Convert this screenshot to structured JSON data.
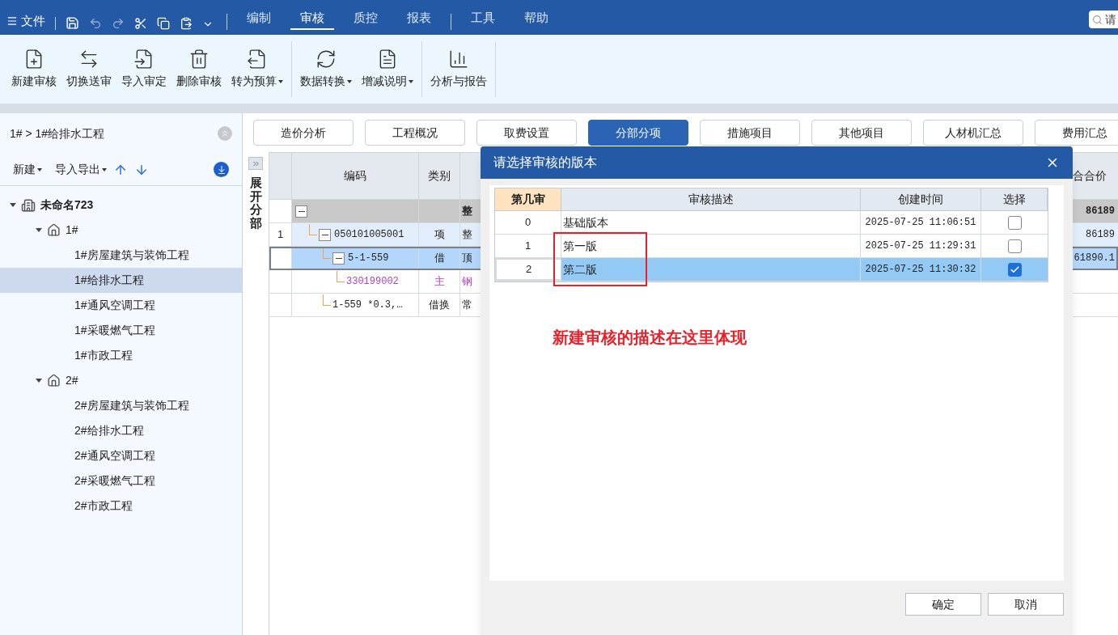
{
  "menu": {
    "file": "文件",
    "tabs": [
      {
        "label": "编制",
        "selected": false,
        "divider_before": false
      },
      {
        "label": "审核",
        "selected": true,
        "divider_before": false
      },
      {
        "label": "质控",
        "selected": false,
        "divider_before": false
      },
      {
        "label": "报表",
        "selected": false,
        "divider_before": false
      },
      {
        "label": "工具",
        "selected": false,
        "divider_before": true
      },
      {
        "label": "帮助",
        "selected": false,
        "divider_before": false
      }
    ],
    "search": {
      "placeholder": "请"
    }
  },
  "ribbon": [
    [
      {
        "label": "新建审核",
        "dropdown": false
      },
      {
        "label": "切换送审",
        "dropdown": false
      },
      {
        "label": "导入审定",
        "dropdown": false
      },
      {
        "label": "删除审核",
        "dropdown": false
      },
      {
        "label": "转为预算",
        "dropdown": true
      }
    ],
    [
      {
        "label": "数据转换",
        "dropdown": true
      },
      {
        "label": "增减说明",
        "dropdown": true
      }
    ],
    [
      {
        "label": "分析与报告",
        "dropdown": false
      }
    ]
  ],
  "sidebar": {
    "breadcrumb": "1# > 1#给排水工程",
    "toolbar": [
      {
        "label": "新建",
        "dropdown": true
      },
      {
        "label": "导入导出",
        "dropdown": true
      }
    ],
    "tree": [
      {
        "label": "未命名723",
        "kind": "project",
        "expanded": true,
        "selected": false,
        "children": [
          {
            "label": "1#",
            "kind": "building",
            "expanded": true,
            "selected": false,
            "children": [
              {
                "label": "1#房屋建筑与装饰工程",
                "selected": false
              },
              {
                "label": "1#给排水工程",
                "selected": true
              },
              {
                "label": "1#通风空调工程",
                "selected": false
              },
              {
                "label": "1#采暖燃气工程",
                "selected": false
              },
              {
                "label": "1#市政工程",
                "selected": false
              }
            ]
          },
          {
            "label": "2#",
            "kind": "building",
            "expanded": true,
            "selected": false,
            "children": [
              {
                "label": "2#房屋建筑与装饰工程",
                "selected": false
              },
              {
                "label": "2#给排水工程",
                "selected": false
              },
              {
                "label": "2#通风空调工程",
                "selected": false
              },
              {
                "label": "2#采暖燃气工程",
                "selected": false
              },
              {
                "label": "2#市政工程",
                "selected": false
              }
            ]
          }
        ]
      }
    ]
  },
  "tabs": [
    {
      "label": "造价分析",
      "selected": false
    },
    {
      "label": "工程概况",
      "selected": false
    },
    {
      "label": "取费设置",
      "selected": false
    },
    {
      "label": "分部分项",
      "selected": true
    },
    {
      "label": "措施项目",
      "selected": false
    },
    {
      "label": "其他项目",
      "selected": false
    },
    {
      "label": "人材机汇总",
      "selected": false
    },
    {
      "label": "费用汇总",
      "selected": false
    }
  ],
  "side_strip": "展开分部",
  "table": {
    "columns": [
      "编码",
      "类别",
      "合合价"
    ],
    "rows": [
      {
        "kind": "group",
        "name": "整",
        "price": "86189",
        "selected": false,
        "children": [
          {
            "kind": "item",
            "num": "1",
            "code": "050101005001",
            "type": "项",
            "name": "整",
            "price": "86189",
            "selected": false,
            "children": [
              {
                "kind": "item",
                "code": "5-1-559",
                "type": "借",
                "name": "顶",
                "price": "61890.1",
                "selected": true,
                "children": [
                  {
                    "kind": "material",
                    "code": "330199002",
                    "type": "主",
                    "name": "钢",
                    "selected": false
                  }
                ]
              },
              {
                "kind": "item",
                "code": "1-559 *0.3,…",
                "type": "借换",
                "name": "常",
                "selected": false
              }
            ]
          }
        ]
      }
    ]
  },
  "dialog": {
    "title": "请选择审核的版本",
    "columns": [
      "第几审",
      "审核描述",
      "创建时间",
      "选择"
    ],
    "rows": [
      {
        "index": "0",
        "description": "基础版本",
        "time": "2025-07-25 11:06:51",
        "checked": false,
        "selected": false
      },
      {
        "index": "1",
        "description": "第一版",
        "time": "2025-07-25 11:29:31",
        "checked": false,
        "selected": false
      },
      {
        "index": "2",
        "description": "第二版",
        "time": "2025-07-25 11:30:32",
        "checked": true,
        "selected": true
      }
    ],
    "annotation": "新建审核的描述在这里体现",
    "buttons": [
      "确定",
      "取消"
    ]
  }
}
